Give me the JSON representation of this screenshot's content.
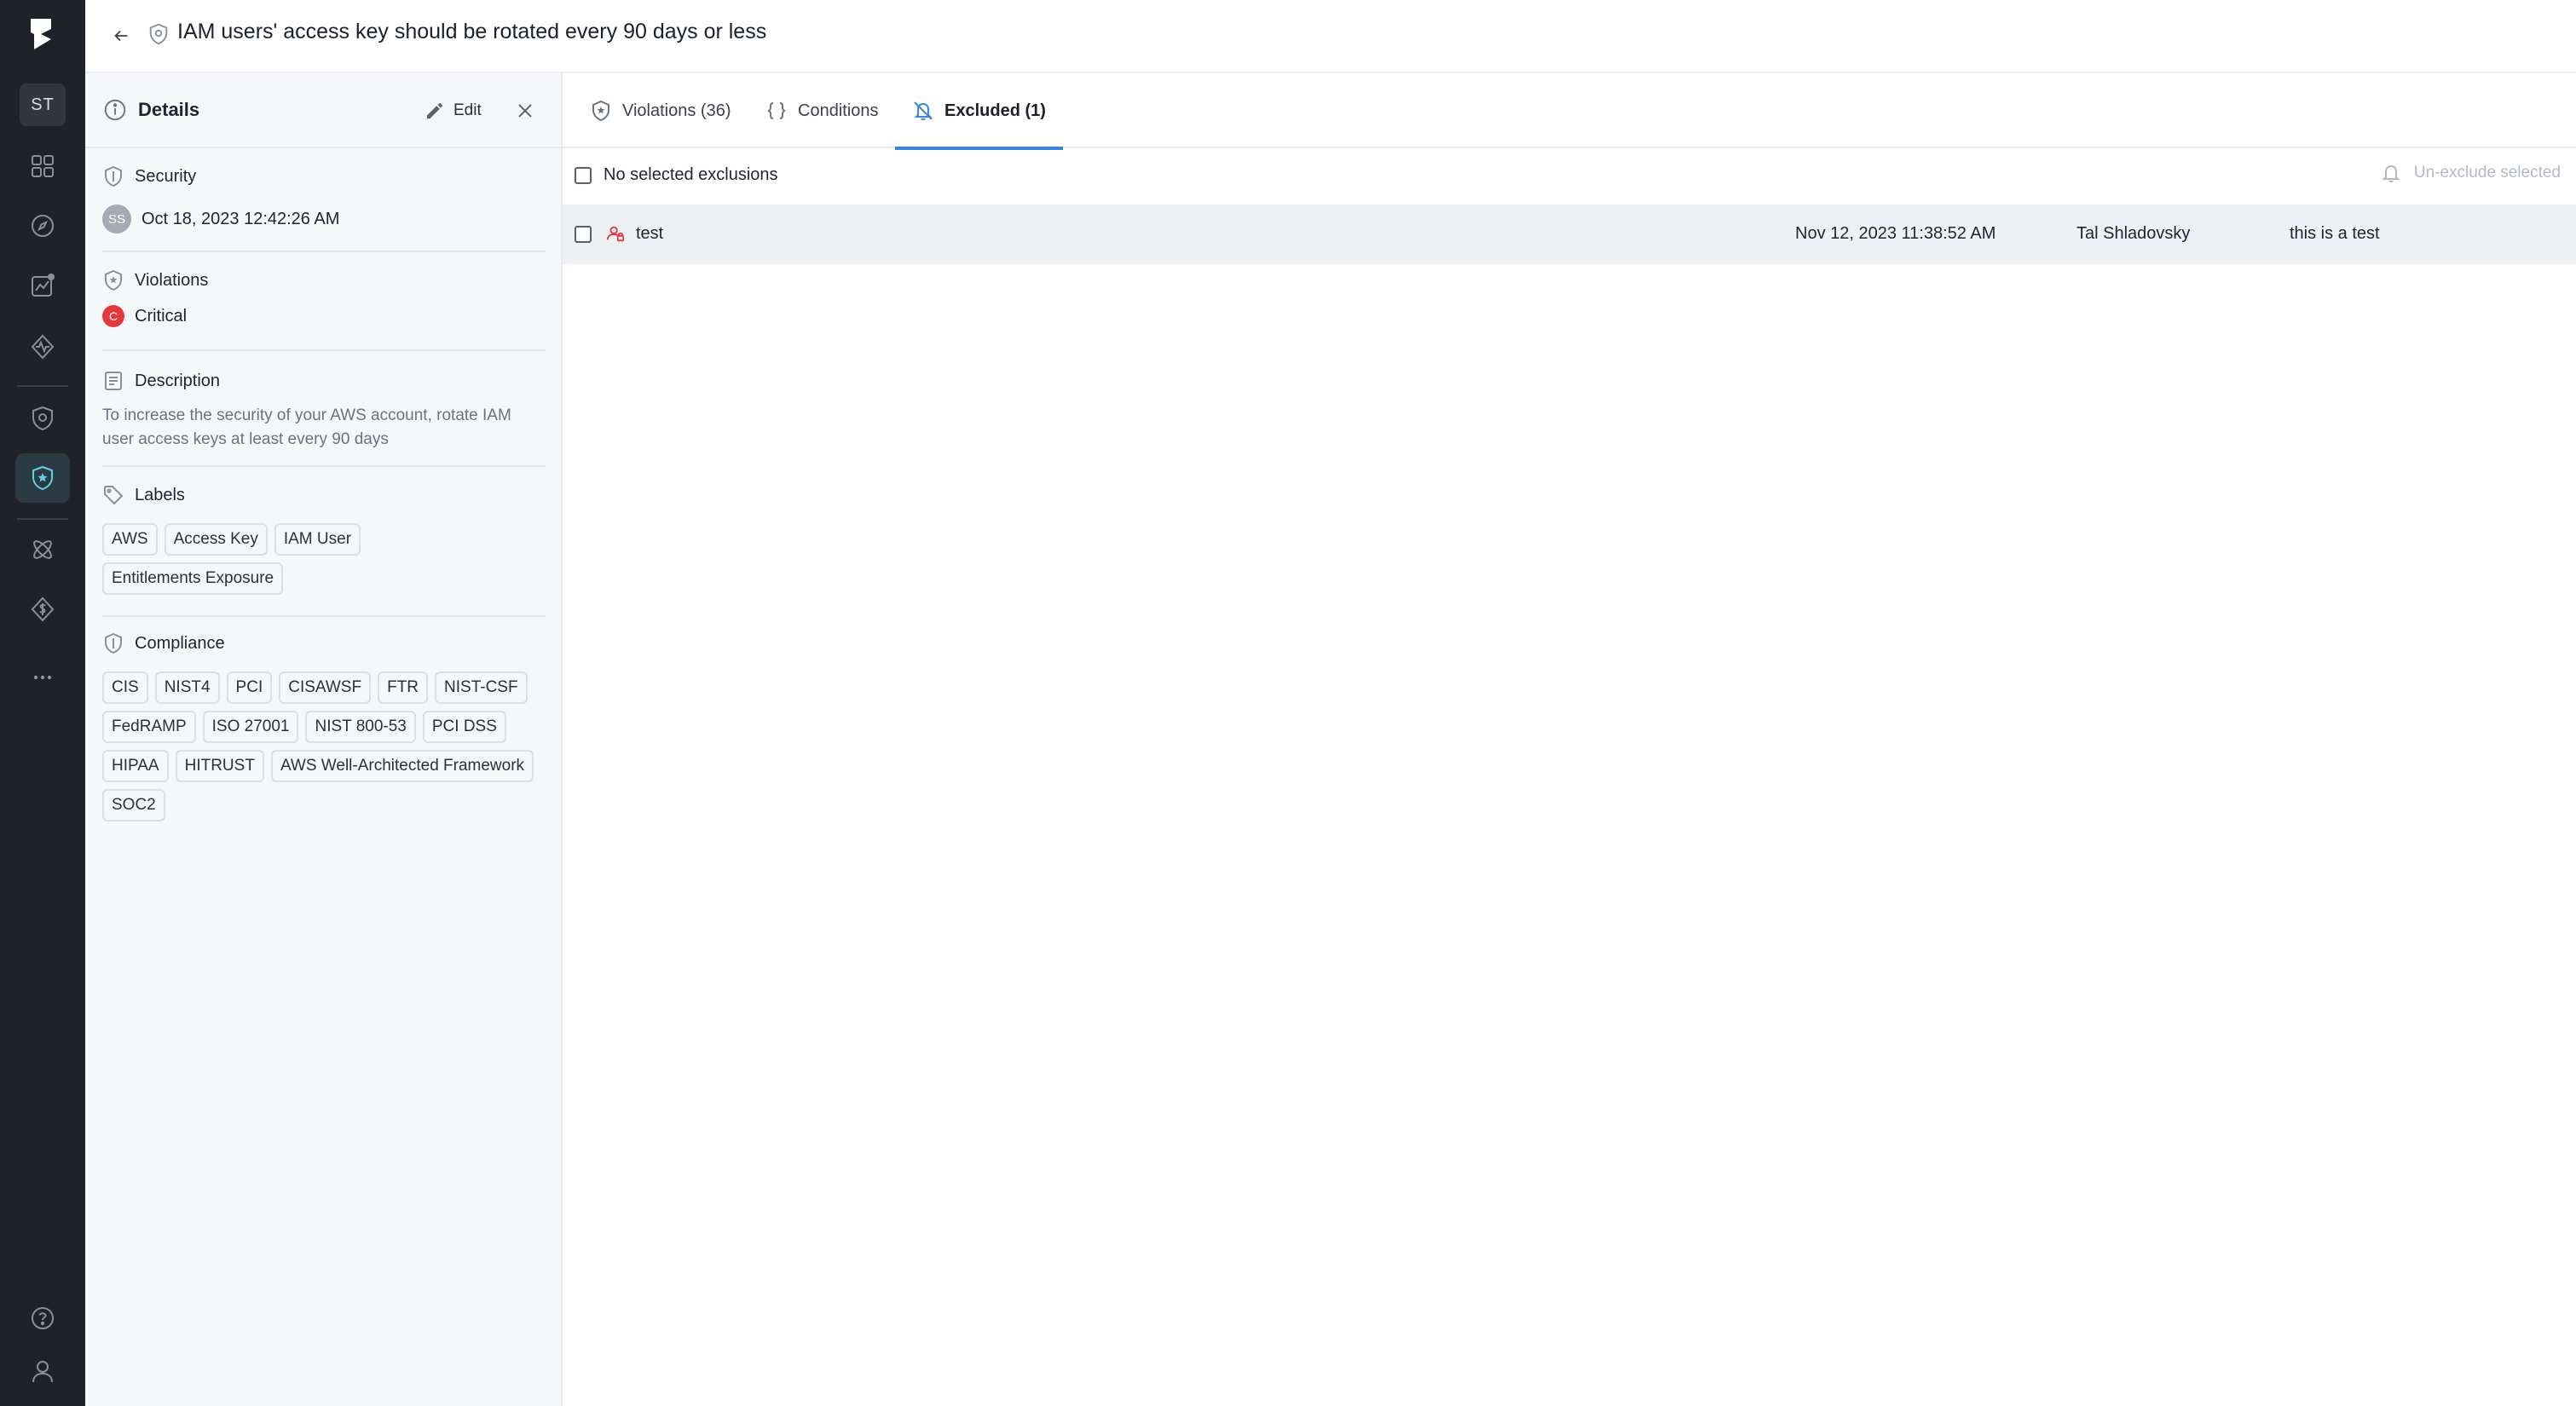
{
  "rail": {
    "avatar_initials": "ST",
    "items": [
      "dashboard-icon",
      "compass-icon",
      "chart-icon",
      "activity-icon",
      "security-shield-icon",
      "policy-shield-icon",
      "atom-icon",
      "cost-icon",
      "more-icon",
      "help-icon",
      "user-icon"
    ],
    "active_item": "policy-shield-icon"
  },
  "header": {
    "title": "IAM users' access key should be rotated every 90 days or less"
  },
  "details": {
    "panel_title": "Details",
    "edit_label": "Edit",
    "security": {
      "heading": "Security",
      "avatar_initials": "SS",
      "date": "Oct 18, 2023 12:42:26 AM"
    },
    "violations": {
      "heading": "Violations",
      "severity_letter": "C",
      "severity": "Critical"
    },
    "description": {
      "heading": "Description",
      "text": "To increase the security of your AWS account, rotate IAM user access keys at least every 90 days"
    },
    "labels": {
      "heading": "Labels",
      "items": [
        "AWS",
        "Access Key",
        "IAM User",
        "Entitlements Exposure"
      ]
    },
    "compliance": {
      "heading": "Compliance",
      "items": [
        "CIS",
        "NIST4",
        "PCI",
        "CISAWSF",
        "FTR",
        "NIST-CSF",
        "FedRAMP",
        "ISO 27001",
        "NIST 800-53",
        "PCI DSS",
        "HIPAA",
        "HITRUST",
        "AWS Well-Architected Framework",
        "SOC2"
      ]
    }
  },
  "tabs": [
    {
      "label": "Violations (36)",
      "icon": "violations-icon"
    },
    {
      "label": "Conditions",
      "icon": "braces-icon"
    },
    {
      "label": "Excluded (1)",
      "icon": "bell-off-icon"
    }
  ],
  "active_tab": "Excluded (1)",
  "toolbar": {
    "selection_label": "No selected exclusions",
    "unexclude_label": "Un-exclude selected"
  },
  "exclusions": [
    {
      "name": "test",
      "date": "Nov 12, 2023 11:38:52 AM",
      "user": "Tal Shladovsky",
      "comment": "this is a test"
    }
  ],
  "colors": {
    "rail_bg": "#1f2227",
    "accent": "#3b82d9",
    "critical": "#e5383b",
    "active_nav": "#2c3b43"
  }
}
